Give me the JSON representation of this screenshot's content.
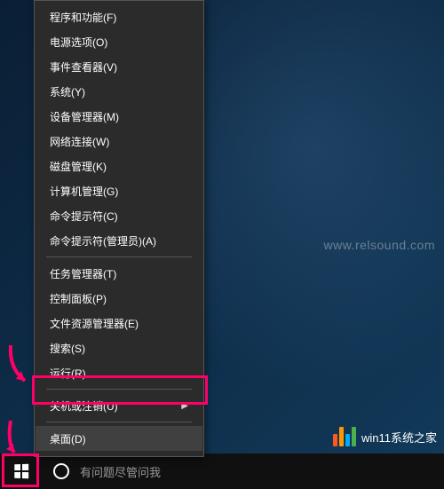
{
  "menu": {
    "items": [
      {
        "label": "程序和功能(F)",
        "hasSubmenu": false
      },
      {
        "label": "电源选项(O)",
        "hasSubmenu": false
      },
      {
        "label": "事件查看器(V)",
        "hasSubmenu": false
      },
      {
        "label": "系统(Y)",
        "hasSubmenu": false
      },
      {
        "label": "设备管理器(M)",
        "hasSubmenu": false
      },
      {
        "label": "网络连接(W)",
        "hasSubmenu": false
      },
      {
        "label": "磁盘管理(K)",
        "hasSubmenu": false
      },
      {
        "label": "计算机管理(G)",
        "hasSubmenu": false
      },
      {
        "label": "命令提示符(C)",
        "hasSubmenu": false
      },
      {
        "label": "命令提示符(管理员)(A)",
        "hasSubmenu": false
      }
    ],
    "items2": [
      {
        "label": "任务管理器(T)",
        "hasSubmenu": false
      },
      {
        "label": "控制面板(P)",
        "hasSubmenu": false
      },
      {
        "label": "文件资源管理器(E)",
        "hasSubmenu": false
      },
      {
        "label": "搜索(S)",
        "hasSubmenu": false
      },
      {
        "label": "运行(R)",
        "hasSubmenu": false
      }
    ],
    "items3": [
      {
        "label": "关机或注销(U)",
        "hasSubmenu": true
      }
    ],
    "items4": [
      {
        "label": "桌面(D)",
        "hasSubmenu": false,
        "hover": true
      }
    ]
  },
  "taskbar": {
    "search_placeholder": "有问题尽管问我"
  },
  "watermark": {
    "text": "win11系统之家",
    "center": "www.relsound.com"
  }
}
